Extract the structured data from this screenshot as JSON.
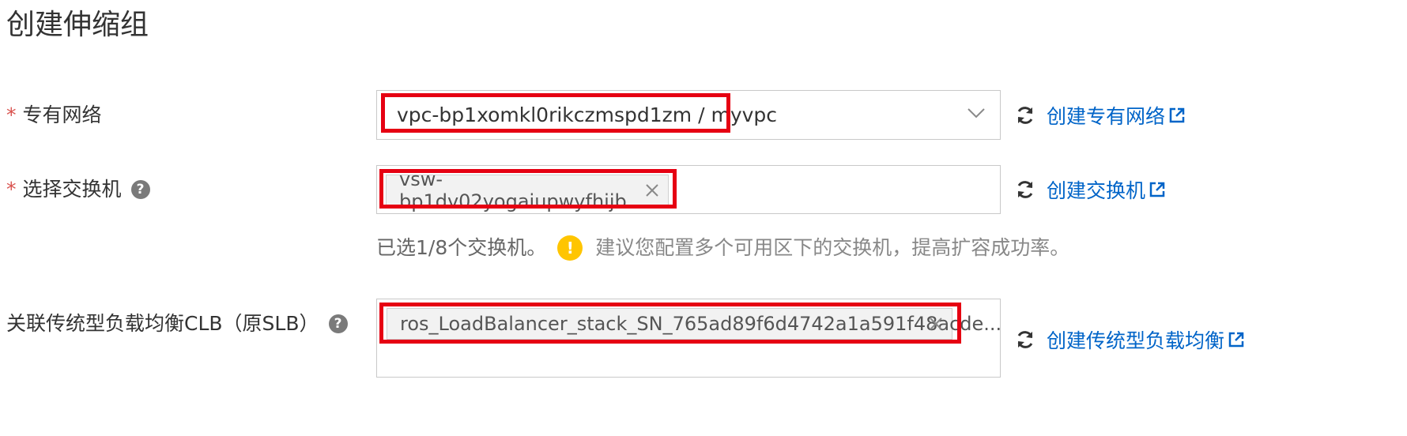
{
  "page": {
    "title": "创建伸缩组"
  },
  "vpc": {
    "required_mark": "*",
    "label": "专有网络",
    "value": "vpc-bp1xomkl0rikczmspd1zm / myvpc",
    "create_link": "创建专有网络"
  },
  "vswitch": {
    "required_mark": "*",
    "label": "选择交换机",
    "help": "?",
    "tag": "vsw-bp1dv02yogaiupwyfhijb",
    "create_link": "创建交换机",
    "hint_selected": "已选1/8个交换机。",
    "hint_warn_icon": "!",
    "hint_text": "建议您配置多个可用区下的交换机，提高扩容成功率。"
  },
  "clb": {
    "label": "关联传统型负载均衡CLB（原SLB）",
    "help": "?",
    "tag": "ros_LoadBalancer_stack_SN_765ad89f6d4742a1a591f48acde...",
    "create_link": "创建传统型负载均衡"
  },
  "colors": {
    "link": "#0064c8",
    "highlight": "#e60012",
    "required": "#d9534f",
    "warning": "#ffc500"
  },
  "icons": [
    "refresh-icon",
    "external-link-icon",
    "chevron-down-icon",
    "close-icon",
    "help-icon",
    "warning-icon"
  ]
}
